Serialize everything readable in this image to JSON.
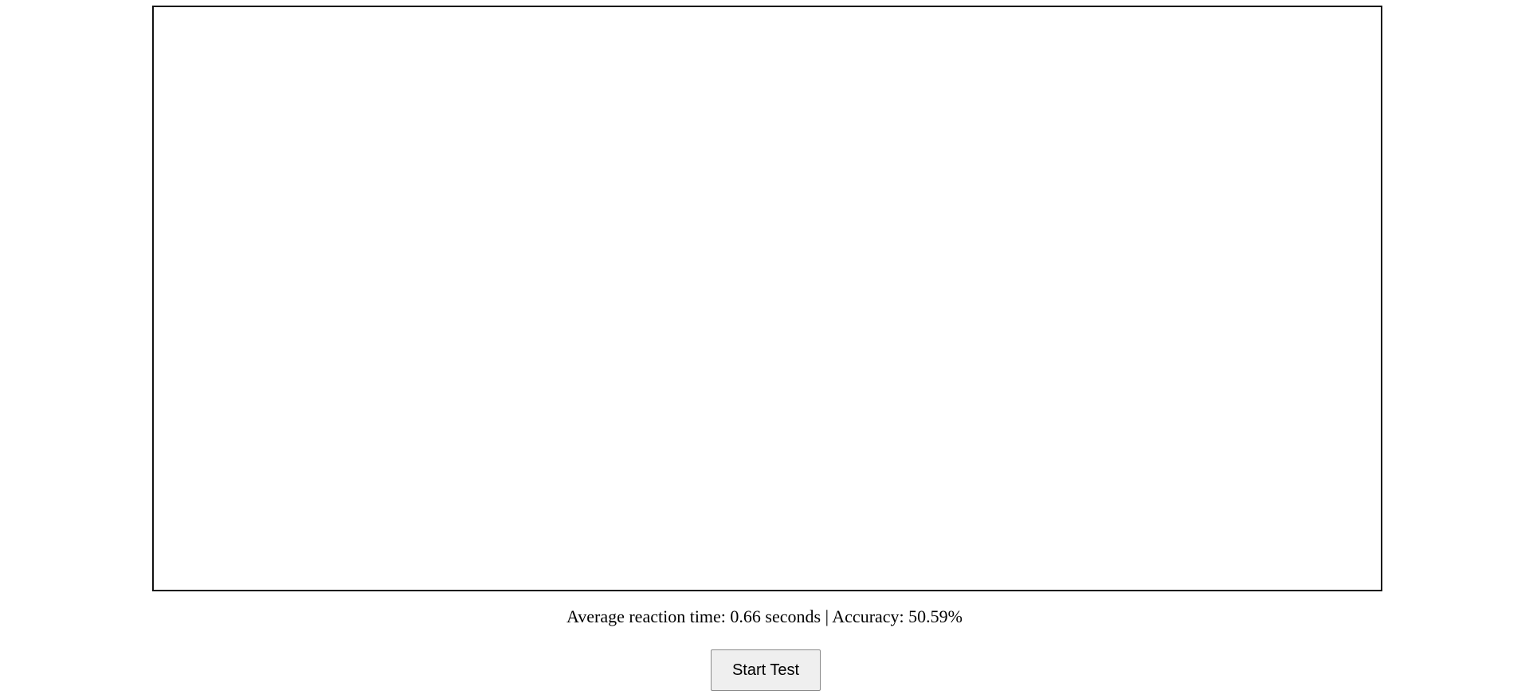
{
  "results": {
    "avg_label": "Average reaction time: ",
    "avg_value": "0.66 seconds",
    "separator": " | ",
    "accuracy_label": "Accuracy: ",
    "accuracy_value": "50.59%"
  },
  "controls": {
    "start_label": "Start Test"
  }
}
